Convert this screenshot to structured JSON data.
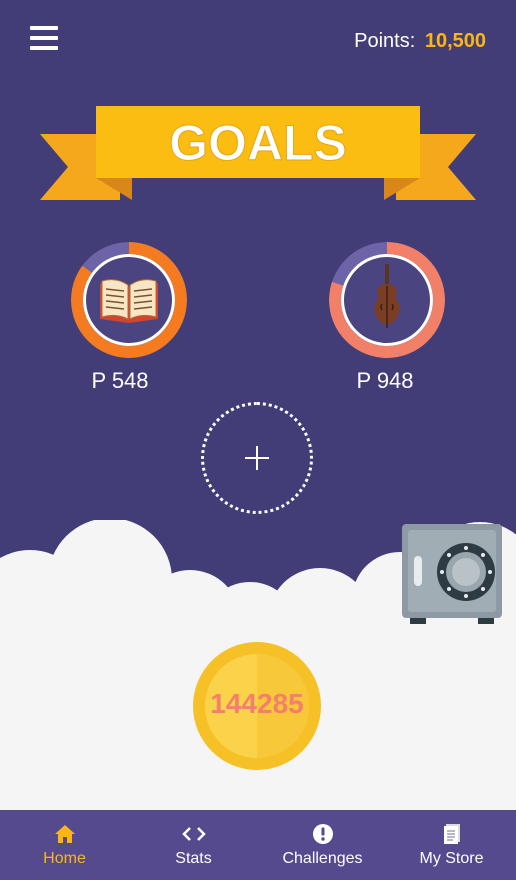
{
  "header": {
    "points_label": "Points:",
    "points_value": "10,500"
  },
  "banner": {
    "title": "GOALS"
  },
  "goals": [
    {
      "name": "book",
      "label": "P 548",
      "progress": 0.85,
      "ring_color": "#f47b20",
      "track_color": "#6d64a8",
      "icon": "open-book-icon"
    },
    {
      "name": "violin",
      "label": "P 948",
      "progress": 0.8,
      "ring_color": "#f28068",
      "track_color": "#6d64a8",
      "icon": "violin-icon"
    }
  ],
  "add_goal": {
    "icon": "plus-icon"
  },
  "coin": {
    "value": "144285"
  },
  "safe": {
    "icon": "safe-icon"
  },
  "nav": {
    "items": [
      {
        "label": "Home",
        "icon": "home-icon",
        "active": true
      },
      {
        "label": "Stats",
        "icon": "code-brackets-icon",
        "active": false
      },
      {
        "label": "Challenges",
        "icon": "exclamation-circle-icon",
        "active": false
      },
      {
        "label": "My Store",
        "icon": "document-icon",
        "active": false
      }
    ]
  },
  "colors": {
    "background": "#423d77",
    "accent": "#fbb616",
    "nav_bg": "#554a8e",
    "cloud": "#f5f5f5"
  }
}
